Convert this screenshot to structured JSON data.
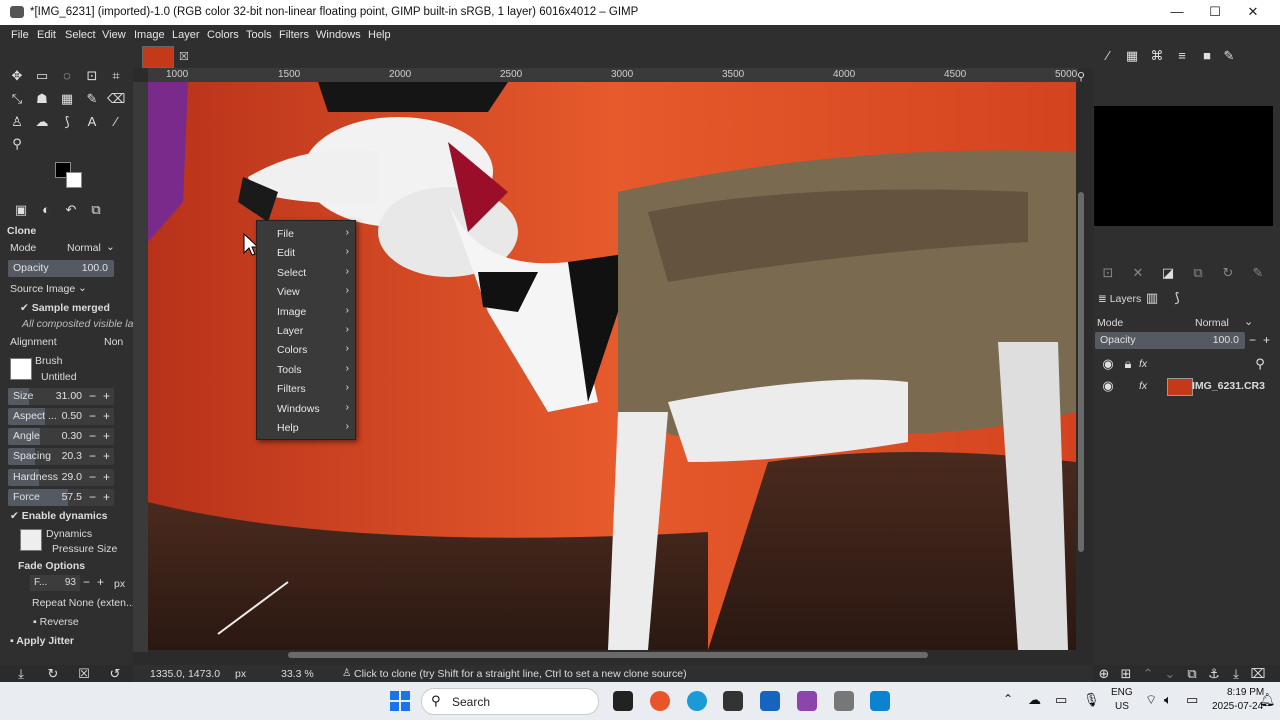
{
  "window": {
    "title": "*[IMG_6231] (imported)-1.0 (RGB color 32-bit non-linear floating point, GIMP built-in sRGB, 1 layer) 6016x4012 – GIMP",
    "minimize": "—",
    "maximize": "☐",
    "close": "✕"
  },
  "menubar": [
    "File",
    "Edit",
    "Select",
    "View",
    "Image",
    "Layer",
    "Colors",
    "Tools",
    "Filters",
    "Windows",
    "Help"
  ],
  "ruler": {
    "ticks": [
      "1000",
      "1500",
      "2000",
      "2500",
      "3000",
      "3500",
      "4000",
      "4500",
      "5000"
    ]
  },
  "tool_options": {
    "title": "Clone",
    "mode_label": "Mode",
    "mode_value": "Normal",
    "opacity": {
      "label": "Opacity",
      "value": "100.0",
      "fraction": 1.0
    },
    "source_label": "Source",
    "source_value": "Image",
    "sample_merged": "Sample merged",
    "sample_note": "All composited visible la",
    "alignment_label": "Alignment",
    "alignment_value": "Non",
    "brush_label": "Brush",
    "brush_name": "Untitled",
    "sliders": [
      {
        "label": "Size",
        "value": "31.00",
        "fraction": 0.2
      },
      {
        "label": "Aspect ...",
        "value": "0.50",
        "fraction": 0.35
      },
      {
        "label": "Angle",
        "value": "0.30",
        "fraction": 0.3
      },
      {
        "label": "Spacing",
        "value": "20.3",
        "fraction": 0.25
      },
      {
        "label": "Hardness",
        "value": "29.0",
        "fraction": 0.29
      },
      {
        "label": "Force",
        "value": "57.5",
        "fraction": 0.57
      }
    ],
    "enable_dynamics": "Enable dynamics",
    "dynamics_label": "Dynamics",
    "dynamics_value": "Pressure Size",
    "fade_options": "Fade Options",
    "fade_field": "F...",
    "fade_value": "93",
    "fade_unit": "px",
    "repeat": "Repeat None (exten...",
    "reverse": "Reverse",
    "apply_jitter": "Apply Jitter"
  },
  "context_menu": [
    "File",
    "Edit",
    "Select",
    "View",
    "Image",
    "Layer",
    "Colors",
    "Tools",
    "Filters",
    "Windows",
    "Help"
  ],
  "status": {
    "coords": "1335.0, 1473.0",
    "unit": "px",
    "zoom": "33.3 %",
    "message": "Click to clone (try Shift for a straight line, Ctrl to set a new clone source)"
  },
  "layers": {
    "tab_label": "Layers",
    "mode_label": "Mode",
    "mode_value": "Normal",
    "opacity_label": "Opacity",
    "opacity_value": "100.0",
    "layer_name": "IMG_6231.CR3",
    "fx": "fx"
  },
  "taskbar": {
    "search": "Search",
    "lang": "ENG",
    "region": "US",
    "time": "8:19 PM",
    "date": "2025-07-24"
  },
  "colors": {
    "canvas_bg": "#d6441f",
    "panel": "#2f2f2f",
    "menu": "#3a3a3a"
  }
}
